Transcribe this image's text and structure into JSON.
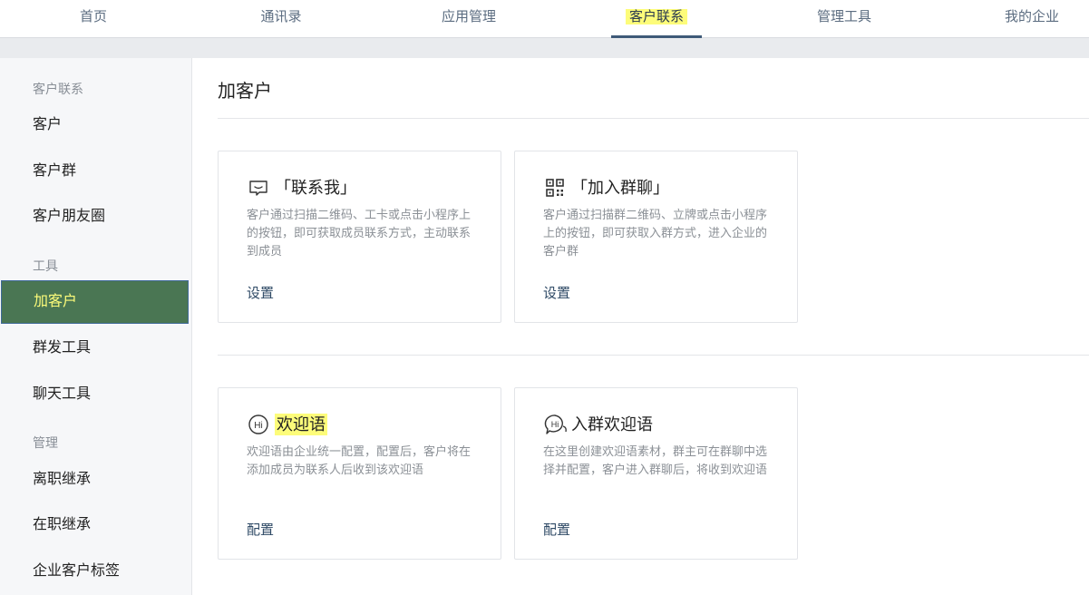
{
  "topnav": {
    "items": [
      {
        "label": "首页"
      },
      {
        "label": "通讯录"
      },
      {
        "label": "应用管理"
      },
      {
        "label": "客户联系"
      },
      {
        "label": "管理工具"
      },
      {
        "label": "我的企业"
      }
    ],
    "active_index": 3
  },
  "sidebar": {
    "sections": [
      {
        "title": "客户联系",
        "items": [
          "客户",
          "客户群",
          "客户朋友圈"
        ]
      },
      {
        "title": "工具",
        "items": [
          "加客户",
          "群发工具",
          "聊天工具"
        ]
      },
      {
        "title": "管理",
        "items": [
          "离职继承",
          "在职继承",
          "企业客户标签"
        ]
      }
    ],
    "active_item": "加客户"
  },
  "main": {
    "title": "加客户",
    "cards": [
      {
        "icon": "message-box-icon",
        "title": "「联系我」",
        "desc": "客户通过扫描二维码、工卡或点击小程序上的按钮，即可获取成员联系方式，主动联系到成员",
        "link": "设置"
      },
      {
        "icon": "qr-code-icon",
        "title": "「加入群聊」",
        "desc": "客户通过扫描群二维码、立牌或点击小程序上的按钮，即可获取入群方式，进入企业的客户群",
        "link": "设置"
      },
      {
        "icon": "hi-bubble-icon",
        "title": "欢迎语",
        "desc": "欢迎语由企业统一配置，配置后，客户将在添加成员为联系人后收到该欢迎语",
        "link": "配置"
      },
      {
        "icon": "hi-group-bubble-icon",
        "title": "入群欢迎语",
        "desc": "在这里创建欢迎语素材，群主可在群聊中选择并配置，客户进入群聊后，将收到欢迎语",
        "link": "配置"
      }
    ]
  },
  "colors": {
    "active_highlight": "#fdfc7a",
    "sidebar_active_bg": "#4a7653",
    "link": "#2f4a66",
    "nav_underline": "#3f5a78"
  }
}
